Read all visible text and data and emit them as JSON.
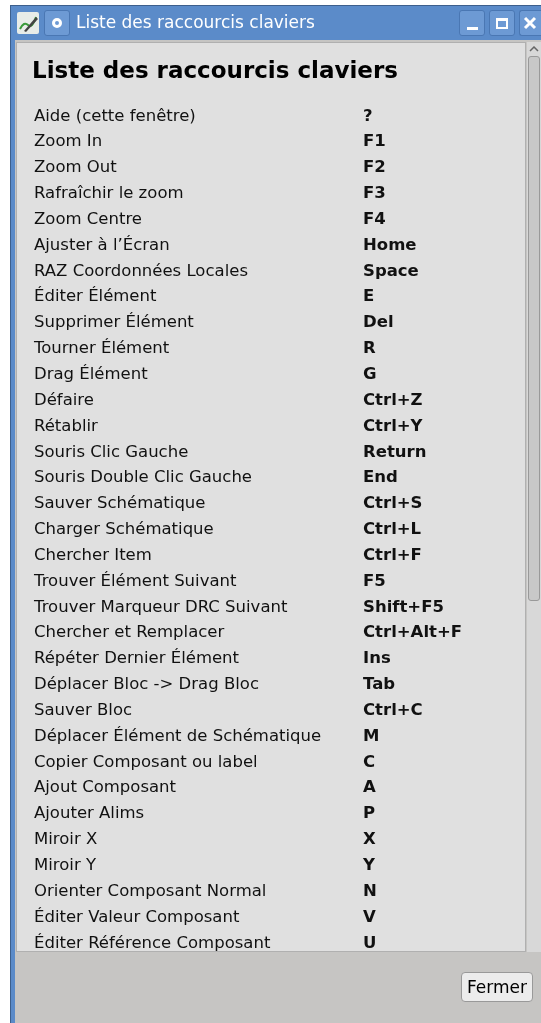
{
  "window": {
    "title": "Liste des raccourcis claviers"
  },
  "heading": "Liste des raccourcis claviers",
  "shortcuts": [
    {
      "action": "Aide (cette fenêtre)",
      "key": "?"
    },
    {
      "action": "Zoom In",
      "key": "F1"
    },
    {
      "action": "Zoom Out",
      "key": "F2"
    },
    {
      "action": "Rafraîchir le zoom",
      "key": "F3"
    },
    {
      "action": "Zoom Centre",
      "key": "F4"
    },
    {
      "action": "Ajuster à l’Écran",
      "key": "Home"
    },
    {
      "action": "RAZ Coordonnées Locales",
      "key": "Space"
    },
    {
      "action": "Éditer Élément",
      "key": "E"
    },
    {
      "action": "Supprimer Élément",
      "key": "Del"
    },
    {
      "action": "Tourner Élément",
      "key": "R"
    },
    {
      "action": "Drag Élément",
      "key": "G"
    },
    {
      "action": "Défaire",
      "key": "Ctrl+Z"
    },
    {
      "action": "Rétablir",
      "key": "Ctrl+Y"
    },
    {
      "action": "Souris Clic Gauche",
      "key": "Return"
    },
    {
      "action": "Souris Double Clic Gauche",
      "key": "End"
    },
    {
      "action": "Sauver Schématique",
      "key": "Ctrl+S"
    },
    {
      "action": "Charger Schématique",
      "key": "Ctrl+L"
    },
    {
      "action": "Chercher Item",
      "key": "Ctrl+F"
    },
    {
      "action": "Trouver Élément Suivant",
      "key": "F5"
    },
    {
      "action": "Trouver Marqueur DRC Suivant",
      "key": "Shift+F5"
    },
    {
      "action": "Chercher et Remplacer",
      "key": "Ctrl+Alt+F"
    },
    {
      "action": "Répéter Dernier Élément",
      "key": "Ins"
    },
    {
      "action": "Déplacer Bloc -> Drag Bloc",
      "key": "Tab"
    },
    {
      "action": "Sauver Bloc",
      "key": "Ctrl+C"
    },
    {
      "action": "Déplacer Élément de Schématique",
      "key": "M"
    },
    {
      "action": "Copier Composant ou label",
      "key": "C"
    },
    {
      "action": "Ajout Composant",
      "key": "A"
    },
    {
      "action": "Ajouter Alims",
      "key": "P"
    },
    {
      "action": "Miroir X",
      "key": "X"
    },
    {
      "action": "Miroir Y",
      "key": "Y"
    },
    {
      "action": "Orienter Composant Normal",
      "key": "N"
    },
    {
      "action": "Éditer Valeur Composant",
      "key": "V"
    },
    {
      "action": "Éditer Référence Composant",
      "key": "U"
    }
  ],
  "buttons": [
    "Fermer"
  ]
}
